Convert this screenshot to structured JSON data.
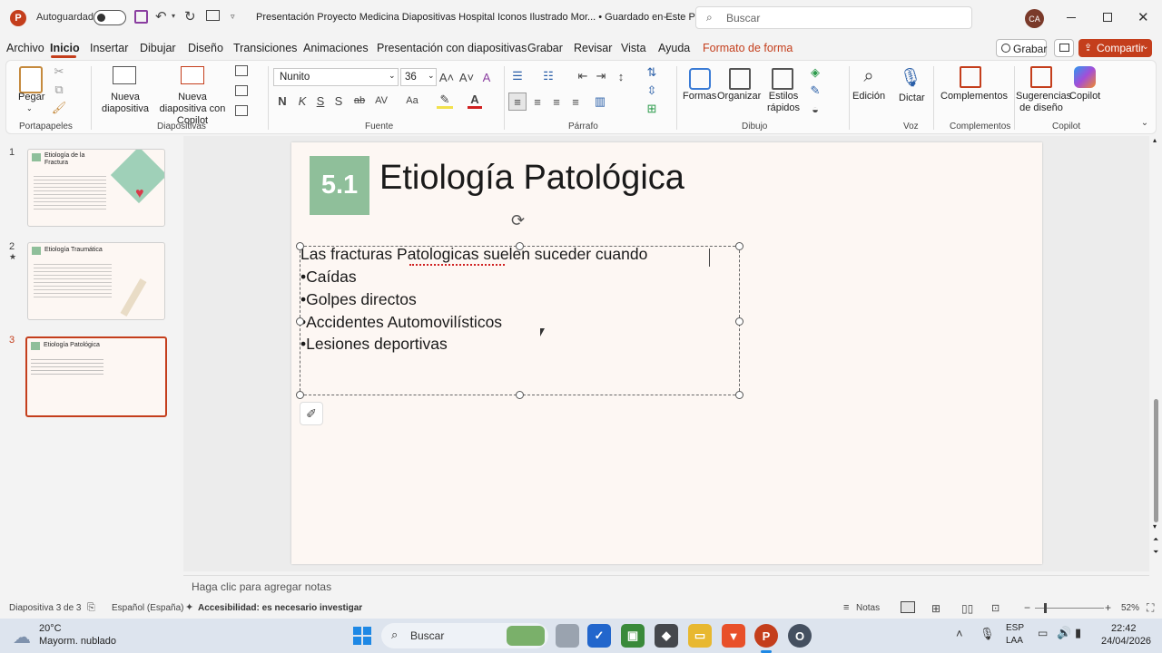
{
  "titlebar": {
    "autosave_label": "Autoguardado",
    "doc_title": "Presentación Proyecto Medicina Diapositivas Hospital Iconos Ilustrado Mor...  •  Guardado en Este PC",
    "search_placeholder": "Buscar",
    "user_initials": "CA"
  },
  "menu": {
    "items": [
      "Archivo",
      "Inicio",
      "Insertar",
      "Dibujar",
      "Diseño",
      "Transiciones",
      "Animaciones",
      "Presentación con diapositivas",
      "Grabar",
      "Revisar",
      "Vista",
      "Ayuda",
      "Formato de forma"
    ],
    "active": "Inicio",
    "record_button": "Grabar",
    "share_button": "Compartir"
  },
  "ribbon": {
    "paste": "Pegar",
    "new_slide": "Nueva diapositiva",
    "new_slide_copilot": "Nueva diapositiva con Copilot",
    "font_name": "Nunito",
    "font_size": "36",
    "shapes": "Formas",
    "arrange": "Organizar",
    "quick_styles": "Estilos rápidos",
    "editing": "Edición",
    "dictate": "Dictar",
    "addins": "Complementos",
    "design_ideas": "Sugerencias de diseño",
    "copilot": "Copilot",
    "groups": [
      "Portapapeles",
      "Diapositivas",
      "Fuente",
      "Párrafo",
      "Dibujo",
      "Voz",
      "Complementos",
      "Copilot"
    ],
    "bold": "N",
    "italic": "K",
    "underline": "S",
    "shadow": "S",
    "strike": "ab",
    "spacing": "AV",
    "case": "Aa"
  },
  "thumbnails": [
    {
      "num": "1",
      "title": "Etiología de la Fractura"
    },
    {
      "num": "2",
      "title": "Etiología Traumática"
    },
    {
      "num": "3",
      "title": "Etiología Patológica"
    }
  ],
  "slide": {
    "badge": "5.1",
    "title": "Etiología Patológica",
    "intro": "Las fracturas Patologicas suelen suceder cuando",
    "bullets": [
      "•Caídas",
      "•Golpes directos",
      "•Accidentes Automovilísticos",
      "•Lesiones deportivas"
    ]
  },
  "notes_placeholder": "Haga clic para agregar notas",
  "status": {
    "slide_info": "Diapositiva 3 de 3",
    "language": "Español (España)",
    "accessibility": "Accesibilidad: es necesario investigar",
    "notes_button": "Notas",
    "zoom": "52%"
  },
  "taskbar": {
    "weather_temp": "20°C",
    "weather_desc": "Mayorm. nublado",
    "search": "Buscar",
    "lang_top": "ESP",
    "lang_bottom": "LAA",
    "time": "22:42",
    "date": "24/04/2026"
  },
  "colors": {
    "accent": "#c43e1c",
    "badge": "#8fbf9a",
    "share": "#c43e1c"
  }
}
